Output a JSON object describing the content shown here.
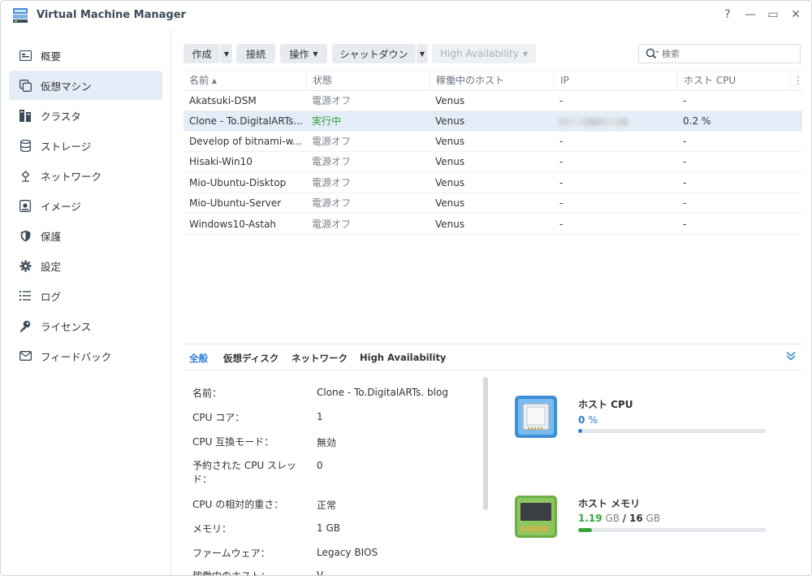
{
  "app": {
    "title": "Virtual Machine Manager"
  },
  "window_controls": [
    "?",
    "—",
    "▭",
    "✕"
  ],
  "sidebar": {
    "items": [
      {
        "label": "概要",
        "icon": "overview-icon"
      },
      {
        "label": "仮想マシン",
        "icon": "vm-icon",
        "active": true
      },
      {
        "label": "クラスタ",
        "icon": "cluster-icon"
      },
      {
        "label": "ストレージ",
        "icon": "storage-icon"
      },
      {
        "label": "ネットワーク",
        "icon": "network-icon"
      },
      {
        "label": "イメージ",
        "icon": "image-icon"
      },
      {
        "label": "保護",
        "icon": "shield-icon"
      },
      {
        "label": "設定",
        "icon": "gear-icon"
      },
      {
        "label": "ログ",
        "icon": "log-icon"
      },
      {
        "label": "ライセンス",
        "icon": "key-icon"
      },
      {
        "label": "フィードバック",
        "icon": "mail-icon"
      }
    ]
  },
  "toolbar": {
    "create": "作成",
    "connect": "接続",
    "action": "操作",
    "shutdown": "シャットダウン",
    "high_availability": "High Availability",
    "search_placeholder": "検索"
  },
  "table": {
    "headers": [
      "名前 ▴",
      "状態",
      "稼働中のホスト",
      "IP",
      "ホスト CPU"
    ],
    "rows": [
      {
        "name": "Akatsuki-DSM",
        "status": "電源オフ",
        "host": "Venus",
        "ip": "-",
        "cpu": "-"
      },
      {
        "name": "Clone - To.DigitalARTs...",
        "status": "実行中",
        "host": "Venus",
        "ip": "",
        "cpu": "0.2 %",
        "selected": true
      },
      {
        "name": "Develop of bitnami-w...",
        "status": "電源オフ",
        "host": "Venus",
        "ip": "-",
        "cpu": "-"
      },
      {
        "name": "Hisaki-Win10",
        "status": "電源オフ",
        "host": "Venus",
        "ip": "-",
        "cpu": "-"
      },
      {
        "name": "Mio-Ubuntu-Disktop",
        "status": "電源オフ",
        "host": "Venus",
        "ip": "-",
        "cpu": "-"
      },
      {
        "name": "Mio-Ubuntu-Server",
        "status": "電源オフ",
        "host": "Venus",
        "ip": "-",
        "cpu": "-"
      },
      {
        "name": "Windows10-Astah",
        "status": "電源オフ",
        "host": "Venus",
        "ip": "-",
        "cpu": "-"
      }
    ]
  },
  "detail": {
    "tabs": [
      "全般",
      "仮想ディスク",
      "ネットワーク",
      "High Availability"
    ],
    "properties": [
      {
        "label": "名前：",
        "value": "Clone - To.DigitalARTs. blog"
      },
      {
        "label": "CPU コア：",
        "value": "1"
      },
      {
        "label": "CPU 互換モード：",
        "value": "無効"
      },
      {
        "label": "予約された CPU スレッド：",
        "value": "0"
      },
      {
        "label": "CPU の相対的重さ：",
        "value": "正常"
      },
      {
        "label": "メモリ：",
        "value": "1 GB"
      },
      {
        "label": "ファームウェア：",
        "value": "Legacy BIOS"
      },
      {
        "label": "稼働中のホスト：",
        "value": "V"
      }
    ],
    "host_cpu": {
      "title": "ホスト CPU",
      "value": "0",
      "unit": "%",
      "percent": 2
    },
    "host_memory": {
      "title": "ホスト メモリ",
      "used": "1.19",
      "used_unit": "GB",
      "sep": "/",
      "total": "16",
      "total_unit": "GB",
      "fraction": 0.074
    },
    "colors": {
      "accent": "#2a7bd6",
      "memory": "#3aa33e",
      "running": "#2e9b36"
    }
  }
}
